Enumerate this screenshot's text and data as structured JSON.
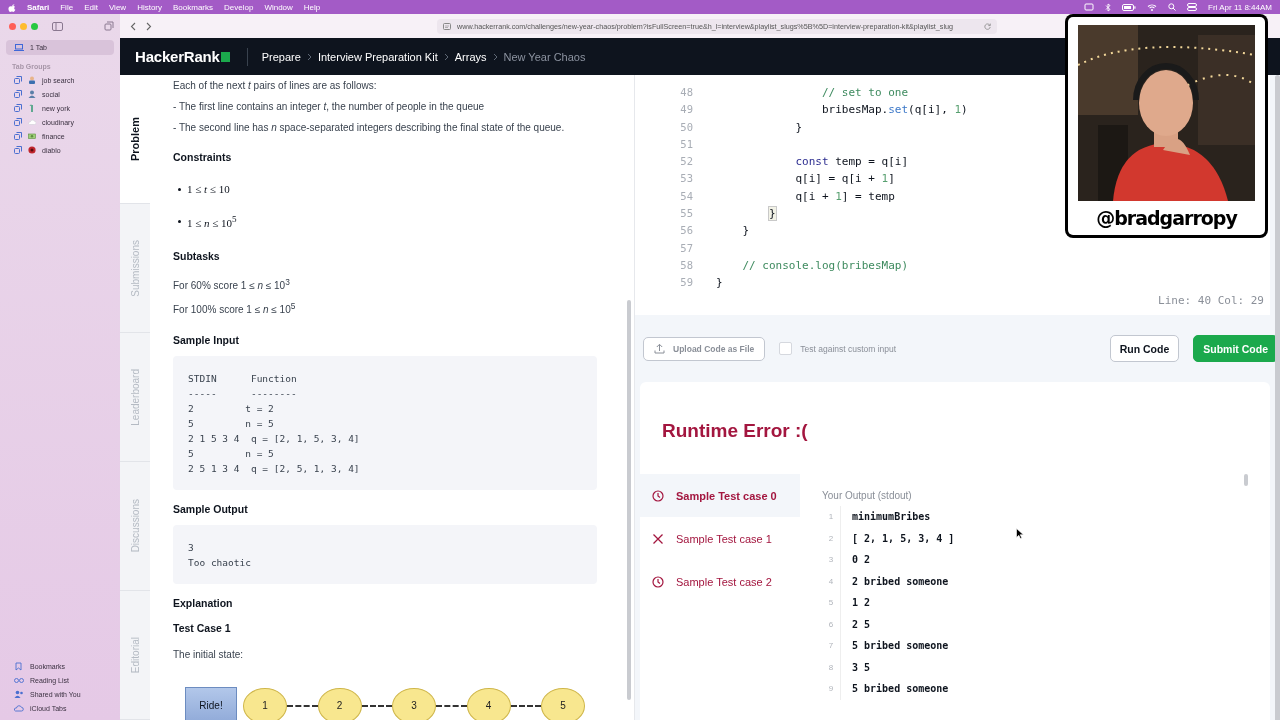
{
  "menu_bar": {
    "app": "Safari",
    "menus": [
      "File",
      "Edit",
      "View",
      "History",
      "Bookmarks",
      "Develop",
      "Window",
      "Help"
    ],
    "clock": "Fri Apr 11  8:44AM"
  },
  "sidebar": {
    "current_tab": "1 Tab",
    "groups_heading": "Tab Groups",
    "tab_groups": [
      {
        "label": "job search",
        "kind": "worker"
      },
      {
        "label": "social",
        "kind": "person"
      },
      {
        "label": "new york",
        "kind": "statue"
      },
      {
        "label": "cloudinary",
        "kind": "cloud"
      },
      {
        "label": "finance",
        "kind": "money"
      },
      {
        "label": "diablo",
        "kind": "disc"
      }
    ],
    "footer_items": [
      {
        "label": "Bookmarks",
        "kind": "bookmark"
      },
      {
        "label": "Reading List",
        "kind": "glasses"
      },
      {
        "label": "Shared with You",
        "kind": "people"
      },
      {
        "label": "iCloud Tabs",
        "kind": "cloud"
      }
    ]
  },
  "address_bar": {
    "url": "www.hackerrank.com/challenges/new-year-chaos/problem?isFullScreen=true&h_l=interview&playlist_slugs%5B%5D=interview-preparation-kit&playlist_slug"
  },
  "site_nav": {
    "logo": "HackerRank",
    "breadcrumbs": [
      {
        "label": "Prepare",
        "current": false
      },
      {
        "label": "Interview Preparation Kit",
        "current": false
      },
      {
        "label": "Arrays",
        "current": false
      },
      {
        "label": "New Year Chaos",
        "current": true
      }
    ]
  },
  "problem_tabs": [
    {
      "label": "Problem",
      "selected": true
    },
    {
      "label": "Submissions",
      "selected": false
    },
    {
      "label": "Leaderboard",
      "selected": false
    },
    {
      "label": "Discussions",
      "selected": false
    },
    {
      "label": "Editorial",
      "selected": false
    }
  ],
  "problem": [
    {
      "kind": "paragraph",
      "text": "Each of the next *t* pairs of lines are as follows:"
    },
    {
      "kind": "paragraph",
      "text": "- The first line contains an integer *t*, the number of people in the queue"
    },
    {
      "kind": "paragraph",
      "text": "- The second line has *n* space-separated integers describing the final state of the queue."
    },
    {
      "kind": "heading",
      "text": "Constraints"
    },
    {
      "kind": "bullets",
      "items": [
        "1 ≤ *t* ≤ 10",
        "1 ≤ *n* ≤ 10$^{5}$"
      ]
    },
    {
      "kind": "heading",
      "text": "Subtasks"
    },
    {
      "kind": "paragraph",
      "text": "For 60% score 1 ≤ *n* ≤ 10$^{3}$"
    },
    {
      "kind": "paragraph",
      "text": "For 100% score 1 ≤ *n* ≤ 10$^{5}$"
    },
    {
      "kind": "heading",
      "text": "Sample Input"
    },
    {
      "kind": "code",
      "lines": [
        "STDIN      Function",
        "-----      --------",
        "2         t = 2",
        "5         n = 5",
        "2 1 5 3 4  q = [2, 1, 5, 3, 4]",
        "5         n = 5",
        "2 5 1 3 4  q = [2, 5, 1, 3, 4]"
      ]
    },
    {
      "kind": "heading",
      "text": "Sample Output"
    },
    {
      "kind": "code",
      "lines": [
        "3",
        "Too chaotic"
      ]
    },
    {
      "kind": "heading",
      "text": "Explanation"
    },
    {
      "kind": "heading",
      "text": "Test Case 1"
    },
    {
      "kind": "paragraph",
      "text": "The initial state:"
    },
    {
      "kind": "diagram",
      "front": "Ride!",
      "people": [
        "1",
        "2",
        "3",
        "4",
        "5"
      ]
    }
  ],
  "editor": {
    "lines": [
      {
        "number": "48",
        "tokens": [
          {
            "kind": "comment",
            "text": "                // set to one"
          }
        ]
      },
      {
        "number": "49",
        "tokens": [
          {
            "kind": "plain",
            "text": "                bribesMap."
          },
          {
            "kind": "method",
            "text": "set"
          },
          {
            "kind": "plain",
            "text": "(q[i], "
          },
          {
            "kind": "number",
            "text": "1"
          },
          {
            "kind": "plain",
            "text": ")"
          }
        ]
      },
      {
        "number": "50",
        "tokens": [
          {
            "kind": "plain",
            "text": "            }"
          }
        ]
      },
      {
        "number": "51"
      },
      {
        "number": "52",
        "tokens": [
          {
            "kind": "keyword",
            "text": "            const"
          },
          {
            "kind": "plain",
            "text": " temp = q[i]"
          }
        ]
      },
      {
        "number": "53",
        "tokens": [
          {
            "kind": "plain",
            "text": "            q[i] = q[i + "
          },
          {
            "kind": "number",
            "text": "1"
          },
          {
            "kind": "plain",
            "text": "]"
          }
        ]
      },
      {
        "number": "54",
        "tokens": [
          {
            "kind": "plain",
            "text": "            q[i + "
          },
          {
            "kind": "number",
            "text": "1"
          },
          {
            "kind": "plain",
            "text": "] = temp"
          }
        ]
      },
      {
        "number": "55",
        "tokens": [
          {
            "kind": "match",
            "text": "        }"
          }
        ]
      },
      {
        "number": "56",
        "tokens": [
          {
            "kind": "plain",
            "text": "    }"
          }
        ]
      },
      {
        "number": "57"
      },
      {
        "number": "58",
        "tokens": [
          {
            "kind": "comment",
            "text": "    // console.log(bribesMap)"
          }
        ]
      },
      {
        "number": "59",
        "tokens": [
          {
            "kind": "plain",
            "text": "}"
          }
        ]
      }
    ],
    "status": "Line: 40 Col: 29"
  },
  "actions": {
    "upload": "Upload Code as File",
    "custom_input": {
      "label": "Test against custom input",
      "checked": false
    },
    "run": "Run Code",
    "submit": "Submit Code"
  },
  "results": {
    "title": "Runtime Error :(",
    "test_cases": [
      {
        "label": "Sample Test case 0",
        "kind": "pending",
        "selected": true
      },
      {
        "label": "Sample Test case 1",
        "kind": "failed",
        "selected": false
      },
      {
        "label": "Sample Test case 2",
        "kind": "pending",
        "selected": false
      }
    ],
    "output": {
      "label": "Your Output (stdout)",
      "lines": [
        {
          "number": "1",
          "text": "minimumBribes"
        },
        {
          "number": "2",
          "text": "[ 2, 1, 5, 3, 4 ]"
        },
        {
          "number": "3",
          "text": "0 2"
        },
        {
          "number": "4",
          "text": "2 bribed someone"
        },
        {
          "number": "5",
          "text": "1 2"
        },
        {
          "number": "6",
          "text": "2 5"
        },
        {
          "number": "7",
          "text": "5 bribed someone"
        },
        {
          "number": "8",
          "text": "3 5"
        },
        {
          "number": "9",
          "text": "5 bribed someone"
        }
      ]
    }
  },
  "webcam": {
    "handle": "@bradgarropy"
  }
}
